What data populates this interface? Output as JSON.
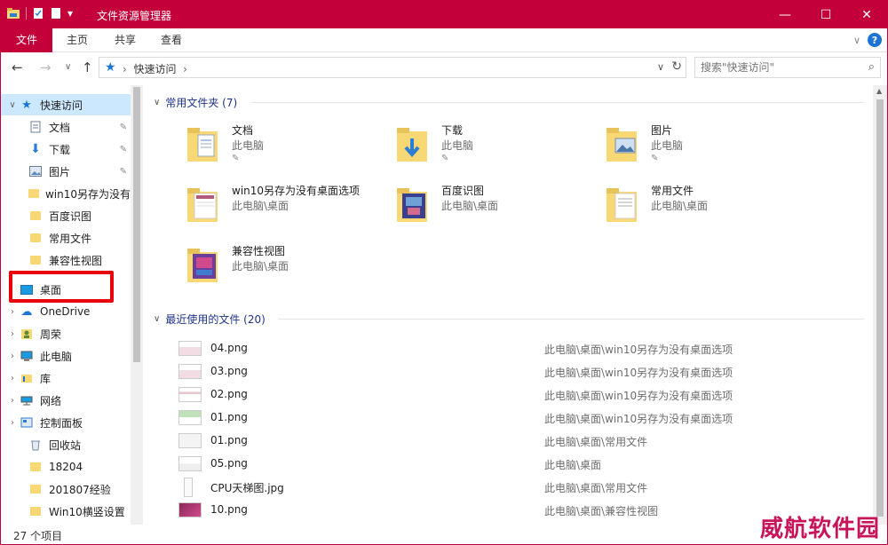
{
  "window": {
    "title": "文件资源管理器"
  },
  "ribbon": {
    "tabs": [
      "文件",
      "主页",
      "共享",
      "查看"
    ]
  },
  "nav": {
    "crumb": "快速访问",
    "search_placeholder": "搜索\"快速访问\""
  },
  "sidebar": {
    "items": [
      {
        "label": "快速访问",
        "icon": "star-icon",
        "pinned": false
      },
      {
        "label": "文档",
        "icon": "document-icon",
        "pinned": true
      },
      {
        "label": "下载",
        "icon": "download-icon",
        "pinned": true
      },
      {
        "label": "图片",
        "icon": "picture-icon",
        "pinned": true
      },
      {
        "label": "win10另存为没有",
        "icon": "folder-icon",
        "pinned": false
      },
      {
        "label": "百度识图",
        "icon": "folder-icon",
        "pinned": false
      },
      {
        "label": "常用文件",
        "icon": "folder-icon",
        "pinned": false
      },
      {
        "label": "兼容性视图",
        "icon": "folder-icon",
        "pinned": false
      },
      {
        "label": "桌面",
        "icon": "desktop-icon",
        "pinned": false
      },
      {
        "label": "OneDrive",
        "icon": "cloud-icon",
        "pinned": false
      },
      {
        "label": "周荣",
        "icon": "user-folder-icon",
        "pinned": false
      },
      {
        "label": "此电脑",
        "icon": "computer-icon",
        "pinned": false
      },
      {
        "label": "库",
        "icon": "library-icon",
        "pinned": false
      },
      {
        "label": "网络",
        "icon": "network-icon",
        "pinned": false
      },
      {
        "label": "控制面板",
        "icon": "control-panel-icon",
        "pinned": false
      },
      {
        "label": "回收站",
        "icon": "recycle-bin-icon",
        "pinned": false
      },
      {
        "label": "18204",
        "icon": "folder-icon",
        "pinned": false
      },
      {
        "label": "201807经验",
        "icon": "folder-icon",
        "pinned": false
      },
      {
        "label": "Win10横竖设置",
        "icon": "folder-icon",
        "pinned": false
      }
    ]
  },
  "frequent": {
    "header": "常用文件夹 (7)",
    "folders": [
      {
        "name": "文档",
        "location": "此电脑",
        "pinned": true
      },
      {
        "name": "下载",
        "location": "此电脑",
        "pinned": true
      },
      {
        "name": "图片",
        "location": "此电脑",
        "pinned": true
      },
      {
        "name": "win10另存为没有桌面选项",
        "location": "此电脑\\桌面",
        "pinned": false
      },
      {
        "name": "百度识图",
        "location": "此电脑\\桌面",
        "pinned": false
      },
      {
        "name": "常用文件",
        "location": "此电脑\\桌面",
        "pinned": false
      },
      {
        "name": "兼容性视图",
        "location": "此电脑\\桌面",
        "pinned": false
      }
    ]
  },
  "recent": {
    "header": "最近使用的文件 (20)",
    "files": [
      {
        "name": "04.png",
        "path": "此电脑\\桌面\\win10另存为没有桌面选项"
      },
      {
        "name": "03.png",
        "path": "此电脑\\桌面\\win10另存为没有桌面选项"
      },
      {
        "name": "02.png",
        "path": "此电脑\\桌面\\win10另存为没有桌面选项"
      },
      {
        "name": "01.png",
        "path": "此电脑\\桌面\\win10另存为没有桌面选项"
      },
      {
        "name": "01.png",
        "path": "此电脑\\桌面\\常用文件"
      },
      {
        "name": "05.png",
        "path": "此电脑\\桌面"
      },
      {
        "name": "CPU天梯图.jpg",
        "path": "此电脑\\桌面\\常用文件"
      },
      {
        "name": "10.png",
        "path": "此电脑\\桌面\\兼容性视图"
      }
    ]
  },
  "status": {
    "count": "27 个项目"
  },
  "watermark": "威航软件园",
  "colors": {
    "accent": "#c3003a",
    "selection": "#cce8ff",
    "folder": "#f8d775",
    "highlight_box": "#e8000b"
  }
}
